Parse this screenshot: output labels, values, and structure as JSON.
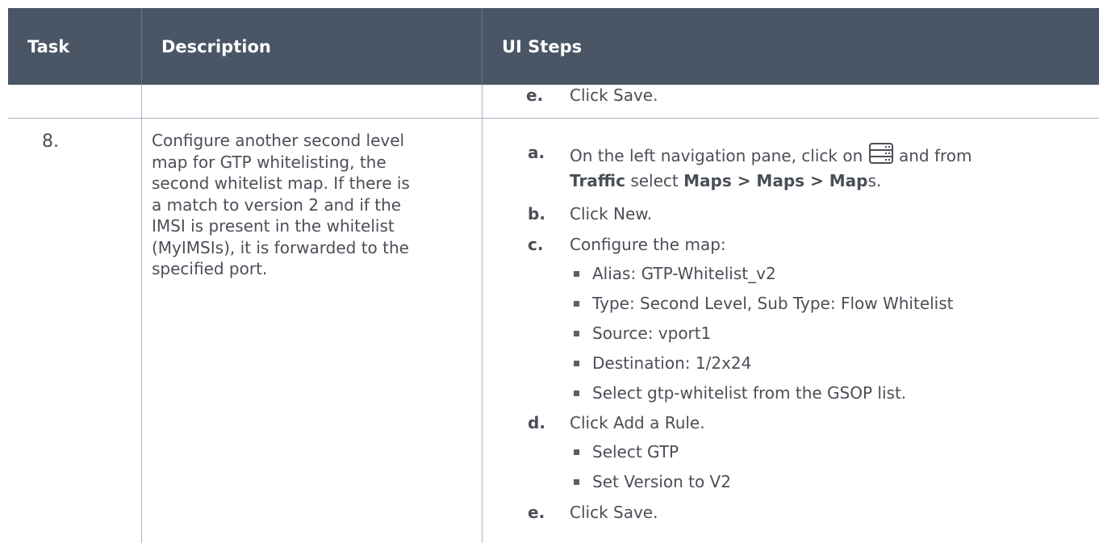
{
  "table": {
    "headers": {
      "task": "Task",
      "description": "Description",
      "ui_steps": "UI Steps"
    },
    "row_prev": {
      "step_e_letter": "e.",
      "step_e_text": "Click Save."
    },
    "row_8": {
      "task_number": "8.",
      "description_lines": [
        "Configure another second level",
        "map for GTP whitelisting, the",
        "second whitelist map. If there is",
        "a match to version 2 and if the",
        "IMSI is present in the whitelist",
        "(MyIMSIs), it is forwarded to the",
        "specified port."
      ],
      "step_a_letter": "a.",
      "step_a_text1": "On the left navigation pane, click on",
      "step_a_icon": "server-stack-icon",
      "step_a_text2": "and from",
      "step_a_bold1": "Traffic",
      "step_a_text3": "select",
      "step_a_bold2": "Maps > Maps > Map",
      "step_a_text4": "s.",
      "step_b_letter": "b.",
      "step_b_text": "Click New.",
      "step_c_letter": "c.",
      "step_c_text": "Configure the map:",
      "step_c_bullets": [
        "Alias: GTP-Whitelist_v2",
        "Type: Second Level, Sub Type: Flow Whitelist",
        "Source: vport1",
        "Destination: 1/2x24",
        "Select gtp-whitelist from the GSOP list."
      ],
      "step_d_letter": "d.",
      "step_d_text": "Click Add a Rule.",
      "step_d_bullets": [
        "Select GTP",
        "Set Version to V2"
      ],
      "step_e_letter": "e.",
      "step_e_text": "Click Save."
    }
  },
  "colors": {
    "header_bg": "#4a5565",
    "rule": "#a9b3c4",
    "text": "#4a4f57"
  }
}
